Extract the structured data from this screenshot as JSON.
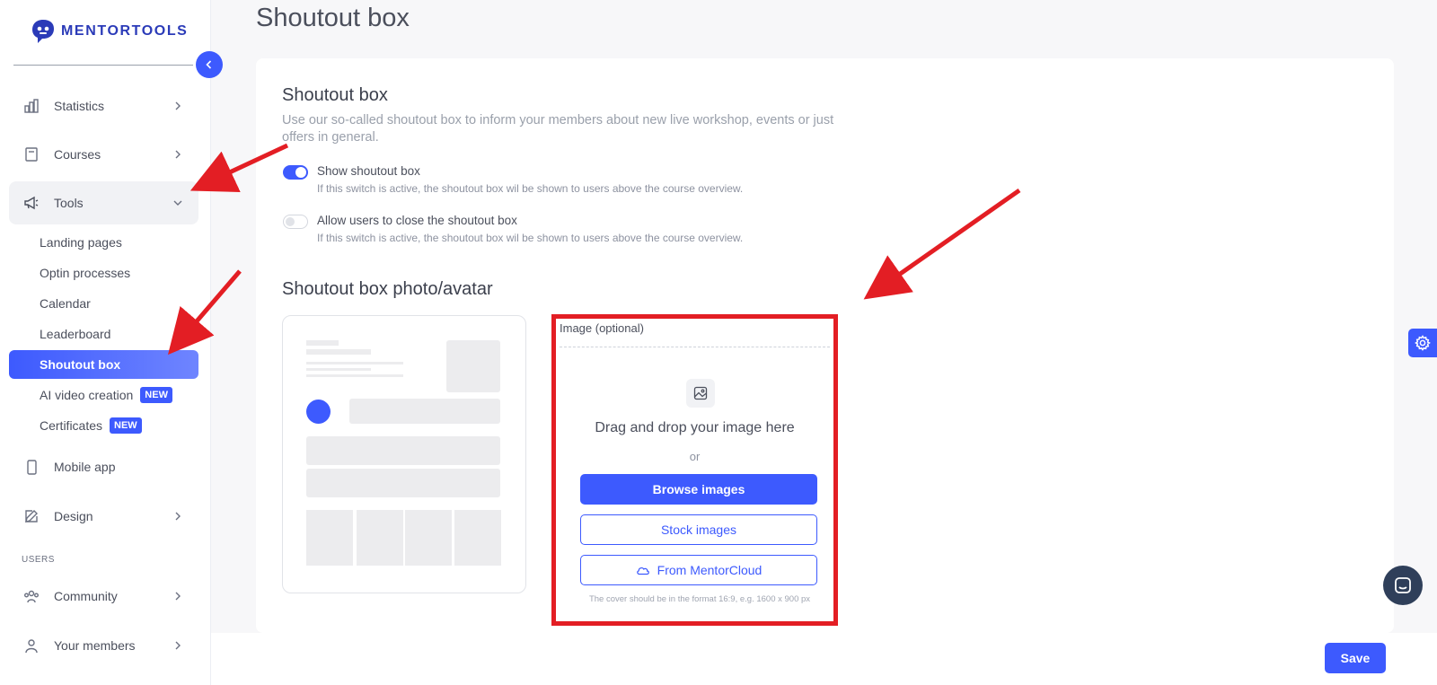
{
  "brand": {
    "name": "MENTORTOOLS"
  },
  "sidebar": {
    "items": [
      {
        "label": "Statistics",
        "icon": "bar-chart-icon"
      },
      {
        "label": "Courses",
        "icon": "book-icon"
      },
      {
        "label": "Tools",
        "icon": "megaphone-icon"
      }
    ],
    "tools_sub": [
      {
        "label": "Landing pages"
      },
      {
        "label": "Optin processes"
      },
      {
        "label": "Calendar"
      },
      {
        "label": "Leaderboard"
      },
      {
        "label": "Shoutout box"
      },
      {
        "label": "AI video creation",
        "badge": "NEW"
      },
      {
        "label": "Certificates",
        "badge": "NEW"
      }
    ],
    "items2": [
      {
        "label": "Mobile app",
        "icon": "phone-icon"
      },
      {
        "label": "Design",
        "icon": "pencil-icon"
      }
    ],
    "section_users": "USERS",
    "items3": [
      {
        "label": "Community",
        "icon": "people-icon"
      },
      {
        "label": "Your members",
        "icon": "user-icon"
      }
    ]
  },
  "page": {
    "title": "Shoutout box"
  },
  "card": {
    "heading": "Shoutout box",
    "description": "Use our so-called shoutout box to inform your members about new live workshop, events or just offers in general.",
    "toggles": [
      {
        "title": "Show shoutout box",
        "help": "If this switch is active, the shoutout box wil be shown to users above the course overview.",
        "on": true
      },
      {
        "title": "Allow users to close the shoutout box",
        "help": "If this switch is active, the shoutout box wil be shown to users above the course overview.",
        "on": false
      }
    ],
    "avatar_heading": "Shoutout box photo/avatar",
    "upload": {
      "label": "Image (optional)",
      "drag_text": "Drag and drop your image here",
      "or_text": "or",
      "browse_label": "Browse images",
      "stock_label": "Stock images",
      "cloud_label": "From MentorCloud",
      "hint": "The cover should be in the format 16:9, e.g. 1600 x 900 px"
    }
  },
  "footer": {
    "save_label": "Save"
  },
  "colors": {
    "accent": "#3d5afe",
    "annotation": "#e31e24"
  }
}
